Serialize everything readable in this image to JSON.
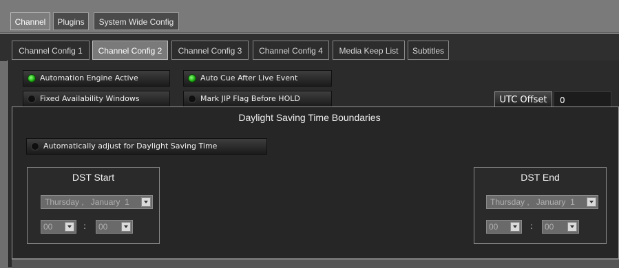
{
  "top_tabs": [
    "Channel",
    "Plugins",
    "System Wide Config"
  ],
  "sub_tabs": [
    "Channel Config 1",
    "Channel Config 2",
    "Channel Config 3",
    "Channel Config 4",
    "Media Keep List",
    "Subtitles"
  ],
  "toggles": {
    "automation_engine": {
      "label": "Automation Engine Active",
      "on": true
    },
    "fixed_windows": {
      "label": "Fixed Availability Windows",
      "on": false
    },
    "auto_cue": {
      "label": "Auto Cue After Live Event",
      "on": true
    },
    "mark_jip": {
      "label": "Mark JIP Flag Before HOLD",
      "on": false
    }
  },
  "utc": {
    "label": "UTC Offset",
    "value": "0"
  },
  "dst": {
    "section_title": "Daylight Saving Time Boundaries",
    "auto_adjust_label": "Automatically adjust for Daylight Saving Time",
    "start": {
      "title": "DST Start",
      "day": "Thursday",
      "sep": ",",
      "month": "January",
      "date": "1",
      "hour": "00",
      "colon": ":",
      "minute": "00"
    },
    "end": {
      "title": "DST End",
      "day": "Thursday",
      "sep": ",",
      "month": "January",
      "date": "1",
      "hour": "00",
      "colon": ":",
      "minute": "00"
    }
  },
  "colors": {
    "led_on": "#1aa810",
    "panel_bg": "#2b2b2b"
  }
}
